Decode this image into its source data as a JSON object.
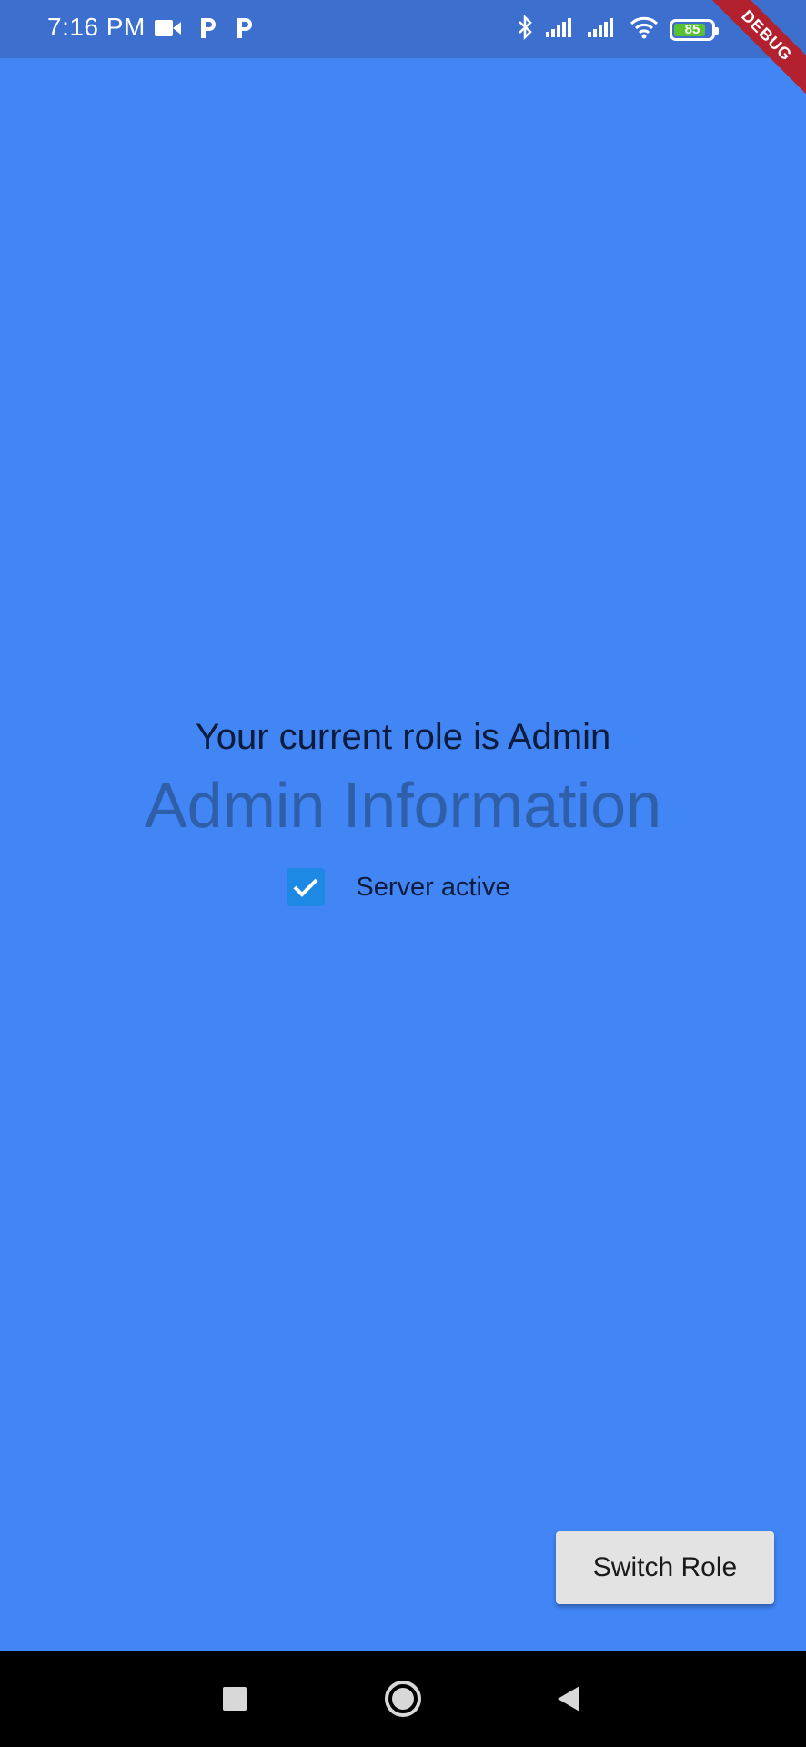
{
  "status_bar": {
    "time": "7:16 PM",
    "left_icons": [
      "video-camera-icon",
      "parking-icon",
      "parking-icon"
    ],
    "right_icons": [
      "bluetooth-icon",
      "signal-icon",
      "signal-icon",
      "wifi-icon"
    ],
    "battery_level": "85",
    "debug_banner": "DEBUG"
  },
  "main": {
    "role_text": "Your current role is Admin",
    "info_title": "Admin Information",
    "checkbox": {
      "label": "Server active",
      "checked": true
    }
  },
  "actions": {
    "switch_role_label": "Switch Role"
  },
  "nav_bar": {
    "buttons": [
      "recent-apps-icon",
      "home-icon",
      "back-icon"
    ]
  },
  "colors": {
    "background": "#4285f4",
    "status_bar": "#3d6fcf",
    "checkbox": "#1e88e5",
    "debug_banner": "#b3212f",
    "battery": "#58c234"
  }
}
